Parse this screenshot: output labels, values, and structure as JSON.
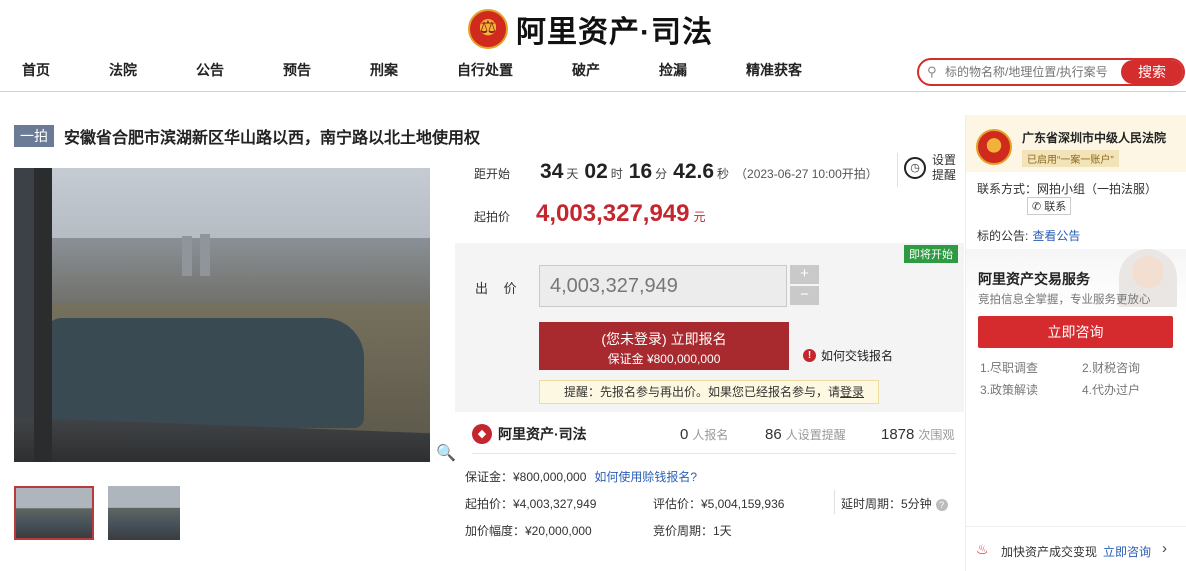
{
  "header": {
    "brand": "阿里资产·司法",
    "nav": [
      "首页",
      "法院",
      "公告",
      "预告",
      "刑案",
      "自行处置",
      "破产",
      "捡漏",
      "精准获客"
    ],
    "search_placeholder": "标的物名称/地理位置/执行案号",
    "search_button": "搜索"
  },
  "item": {
    "round_tag": "一拍",
    "title": "安徽省合肥市滨湖新区华山路以西，南宁路以北土地使用权"
  },
  "countdown": {
    "label": "距开始",
    "days": "34",
    "days_unit": "天",
    "hours": "02",
    "hours_unit": "时",
    "minutes": "16",
    "minutes_unit": "分",
    "seconds": "42.6",
    "seconds_unit": "秒",
    "start_note": "（2023-06-27 10:00开拍）"
  },
  "remind": {
    "line1": "设置",
    "line2": "提醒"
  },
  "start_price": {
    "label": "起拍价",
    "amount": "4,003,327,949",
    "unit": "元"
  },
  "bid": {
    "status_badge": "即将开始",
    "label": "出 价",
    "value": "4,003,327,949",
    "plus": "+",
    "minus": "−",
    "signup_line1": "(您未登录) 立即报名",
    "signup_line2": "保证金 ¥800,000,000",
    "howpay": "如何交钱报名",
    "tip_text": "提醒：先报名参与再出价。如果您已经报名参与，请",
    "tip_link": "登录"
  },
  "stats": {
    "brand": "阿里资产·司法",
    "signup_count": "0",
    "signup_unit": "人报名",
    "remind_count": "86",
    "remind_unit": "人设置提醒",
    "watch_count": "1878",
    "watch_unit": "次围观"
  },
  "details": {
    "deposit": "保证金：¥800,000,000",
    "deposit_link": "如何使用赊钱报名?",
    "start_price": "起拍价：¥4,003,327,949",
    "assess_price": "评估价：¥5,004,159,936",
    "delay": "延时周期：5分钟",
    "increment": "加价幅度：¥20,000,000",
    "bid_period": "竞价周期：1天"
  },
  "court": {
    "name": "广东省深圳市中级人民法院",
    "badge": "已启用“一案一账户”",
    "contact": "联系方式：网拍小组（一拍法服）",
    "contact_button": "联系",
    "notice_label": "标的公告:",
    "notice_link": "查看公告"
  },
  "service": {
    "title": "阿里资产交易服务",
    "subtitle": "竞拍信息全掌握，专业服务更放心",
    "button": "立即咨询",
    "items": [
      "1.尽职调查",
      "2.财税咨询",
      "3.政策解读",
      "4.代办过户"
    ]
  },
  "bottom": {
    "text": "加快资产成交变现",
    "link": "立即咨询"
  },
  "colors": {
    "brand_red": "#c4262e",
    "link_blue": "#2a5fb8",
    "status_green": "#2e9b43"
  }
}
